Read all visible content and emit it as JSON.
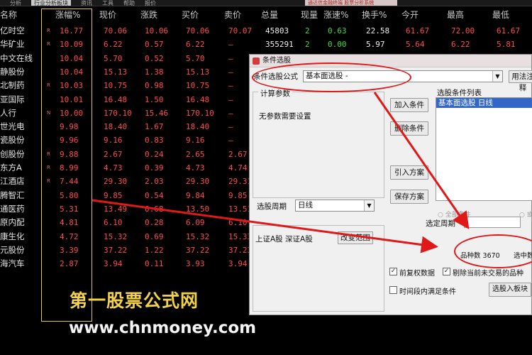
{
  "topbar": {
    "tabs": [
      "分析",
      "行业分析板块",
      "资讯",
      "工具",
      "帮助",
      "报价"
    ],
    "ticker": "通达信金融终端 股票分析系统"
  },
  "table": {
    "columns": [
      "名称",
      "涨幅%",
      "现价",
      "涨跌",
      "买价",
      "卖价",
      "总量",
      "现量",
      "涨速%",
      "换手%",
      "今开",
      "最高",
      "最低"
    ],
    "rows": [
      {
        "name": "亿时空",
        "mark": "R",
        "pct": "16.77",
        "price": "70.06",
        "chg": "10.06",
        "bid": "70.06",
        "ask": "70.07",
        "vol": "45803",
        "cur": "2",
        "speed": "0.63",
        "turn": "22.58",
        "open": "61.67",
        "high": "72.00",
        "low": "61.67"
      },
      {
        "name": "华矿业",
        "mark": "R",
        "pct": "10.09",
        "price": "6.22",
        "chg": "0.57",
        "bid": "6.22",
        "ask": "—",
        "vol": "355291",
        "cur": "2",
        "speed": "0.00",
        "turn": "5.97",
        "open": "5.64",
        "high": "6.22",
        "low": "5.81"
      },
      {
        "name": "中文在线",
        "mark": "",
        "pct": "10.04",
        "price": "5.70",
        "chg": "0.52",
        "bid": "5.70",
        "ask": "—",
        "vol": "",
        "cur": "",
        "speed": "",
        "turn": "",
        "open": "",
        "high": "",
        "low": ""
      },
      {
        "name": "静股份",
        "mark": "",
        "pct": "10.04",
        "price": "15.13",
        "chg": "1.38",
        "bid": "15.13",
        "ask": "—",
        "vol": "",
        "cur": "",
        "speed": "",
        "turn": "",
        "open": "",
        "high": "",
        "low": ""
      },
      {
        "name": "北制药",
        "mark": "R",
        "pct": "10.03",
        "price": "10.75",
        "chg": "0.98",
        "bid": "10.75",
        "ask": "—",
        "vol": "",
        "cur": "",
        "speed": "",
        "turn": "",
        "open": "",
        "high": "",
        "low": ""
      },
      {
        "name": "亚国际",
        "mark": "",
        "pct": "10.01",
        "price": "16.48",
        "chg": "1.50",
        "bid": "16.48",
        "ask": "—",
        "vol": "",
        "cur": "",
        "speed": "",
        "turn": "",
        "open": "",
        "high": "",
        "low": ""
      },
      {
        "name": "人行",
        "mark": "N",
        "pct": "10.00",
        "price": "170.10",
        "chg": "15.46",
        "bid": "170.10",
        "ask": "—",
        "vol": "",
        "cur": "",
        "speed": "",
        "turn": "",
        "open": "",
        "high": "",
        "low": ""
      },
      {
        "name": "世光电",
        "mark": "",
        "pct": "9.98",
        "price": "18.40",
        "chg": "1.67",
        "bid": "18.40",
        "ask": "—",
        "vol": "",
        "cur": "",
        "speed": "",
        "turn": "",
        "open": "",
        "high": "",
        "low": ""
      },
      {
        "name": "瓷股份",
        "mark": "",
        "pct": "9.96",
        "price": "9.16",
        "chg": "0.83",
        "bid": "9.16",
        "ask": "—",
        "vol": "",
        "cur": "",
        "speed": "",
        "turn": "",
        "open": "",
        "high": "",
        "low": ""
      },
      {
        "name": "创股份",
        "mark": "R",
        "pct": "9.88",
        "price": "2.67",
        "chg": "0.24",
        "bid": "2.65",
        "ask": "2.67",
        "vol": "",
        "cur": "",
        "speed": "",
        "turn": "",
        "open": "",
        "high": "",
        "low": ""
      },
      {
        "name": "东方A",
        "mark": "R",
        "pct": "8.99",
        "price": "4.73",
        "chg": "0.39",
        "bid": "4.73",
        "ask": "4.74",
        "vol": "",
        "cur": "",
        "speed": "",
        "turn": "",
        "open": "",
        "high": "",
        "low": ""
      },
      {
        "name": "江酒店",
        "mark": "R",
        "pct": "7.44",
        "price": "29.30",
        "chg": "2.03",
        "bid": "29.30",
        "ask": "29.31",
        "vol": "",
        "cur": "",
        "speed": "",
        "turn": "",
        "open": "",
        "high": "",
        "low": ""
      },
      {
        "name": "腾智汇",
        "mark": "",
        "pct": "5.80",
        "price": "9.85",
        "chg": "0.54",
        "bid": "9.84",
        "ask": "9.85",
        "vol": "",
        "cur": "",
        "speed": "",
        "turn": "",
        "open": "",
        "high": "",
        "low": ""
      },
      {
        "name": "通医药",
        "mark": "",
        "pct": "5.31",
        "price": "13.49",
        "chg": "0.68",
        "bid": "13.50",
        "ask": "13.51",
        "vol": "",
        "cur": "",
        "speed": "",
        "turn": "",
        "open": "",
        "high": "",
        "low": ""
      },
      {
        "name": "原内配",
        "mark": "",
        "pct": "4.81",
        "price": "6.10",
        "chg": "0.28",
        "bid": "6.09",
        "ask": "6.10",
        "vol": "",
        "cur": "",
        "speed": "",
        "turn": "",
        "open": "",
        "high": "",
        "low": ""
      },
      {
        "name": "康生化",
        "mark": "",
        "pct": "4.72",
        "price": "15.32",
        "chg": "0.69",
        "bid": "15.32",
        "ask": "15.33",
        "vol": "",
        "cur": "",
        "speed": "",
        "turn": "",
        "open": "",
        "high": "",
        "low": ""
      },
      {
        "name": "元股份",
        "mark": "",
        "pct": "3.39",
        "price": "37.22",
        "chg": "1.22",
        "bid": "37.22",
        "ask": "37.23",
        "vol": "",
        "cur": "",
        "speed": "",
        "turn": "",
        "open": "",
        "high": "",
        "low": ""
      },
      {
        "name": "海汽车",
        "mark": "",
        "pct": "2.87",
        "price": "3.94",
        "chg": "0.11",
        "bid": "3.93",
        "ask": "3.94",
        "vol": "",
        "cur": "",
        "speed": "",
        "turn": "",
        "open": "",
        "high": "",
        "low": ""
      }
    ]
  },
  "dialog": {
    "title": "条件选股",
    "formula_label": "条件选股公式",
    "formula_value": "基本面选股  -",
    "edit_formula_btn": "用法注释",
    "params_group": "计算参数",
    "params_text": "无参数需要设置",
    "add_condition_btn": "加入条件",
    "delete_condition_btn": "删除条件",
    "import_plan_btn": "引入方案",
    "save_plan_btn": "保存方案",
    "condition_list_label": "选股条件列表",
    "condition_list_item": "基本面选股  日线",
    "all_conditions_radio": "全部条件",
    "any_condition_radio": "或",
    "period_label": "选股周期",
    "period_value": "日线",
    "scope_text": "上证A股  深证A股",
    "change_scope_btn": "改变范围",
    "date_period_label": "选定周期",
    "count_label": "品种数",
    "count_value": "3670",
    "selected_label": "选中数",
    "pre_rights_chk": "前复权数据",
    "exclude_chk": "剔除当前未交易的品种",
    "time_period_chk": "时间段内满足条件",
    "select_into_block_btn": "选股入板块"
  },
  "watermark": {
    "title": "第一股票公式网",
    "url": "www.chnmoney.com"
  }
}
